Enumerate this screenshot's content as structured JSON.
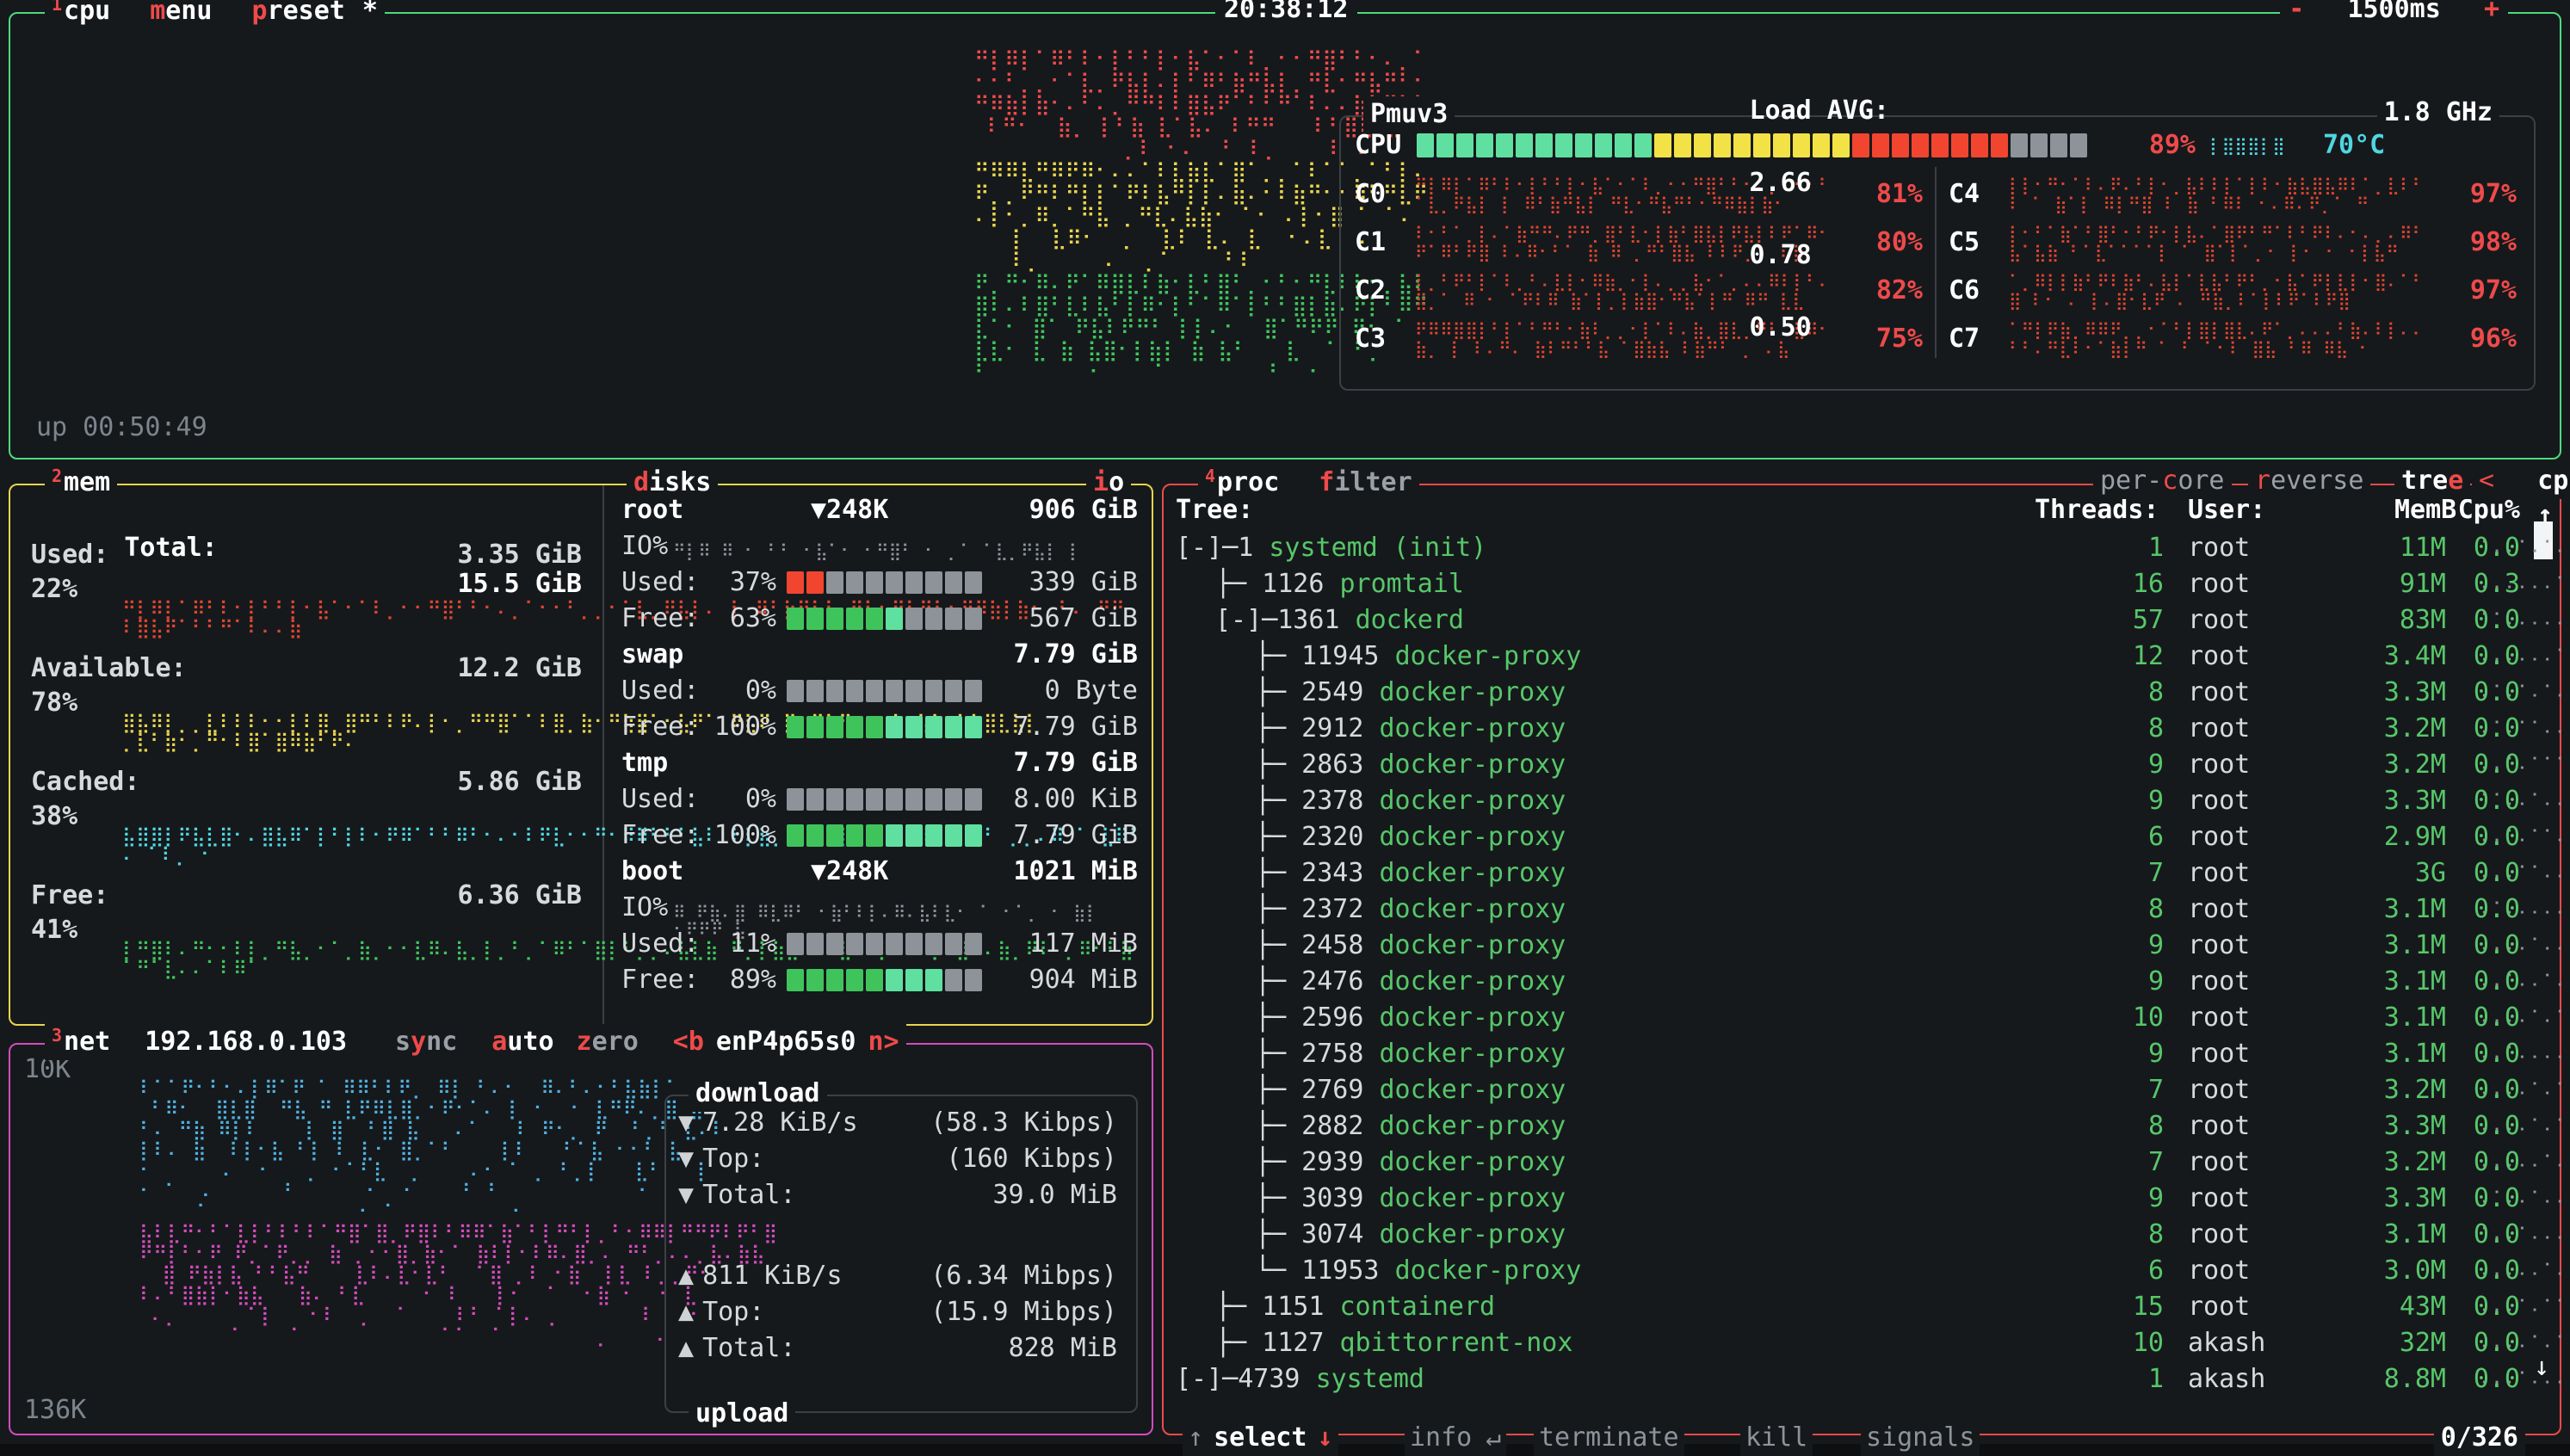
{
  "header": {
    "clock": "20:38:12",
    "update_minus": "-",
    "update_rate": "1500ms",
    "update_plus": "+"
  },
  "cpu": {
    "box_number": "1",
    "title": "cpu",
    "menu_label": "menu",
    "preset_label": "preset",
    "preset_value": "*",
    "uptime": "up 00:50:49",
    "model": "Pmuv3",
    "freq": "1.8 GHz",
    "total_label": "CPU",
    "total_pct": "89%",
    "temp": "70°C",
    "cores_left": [
      {
        "name": "C0",
        "pct": "81%"
      },
      {
        "name": "C1",
        "pct": "80%"
      },
      {
        "name": "C2",
        "pct": "82%"
      },
      {
        "name": "C3",
        "pct": "75%"
      }
    ],
    "cores_right": [
      {
        "name": "C4",
        "pct": "97%"
      },
      {
        "name": "C5",
        "pct": "98%"
      },
      {
        "name": "C6",
        "pct": "97%"
      },
      {
        "name": "C7",
        "pct": "96%"
      }
    ],
    "load_label": "Load AVG:",
    "load_1": "2.66",
    "load_5": "0.78",
    "load_15": "0.50"
  },
  "mem": {
    "box_number": "2",
    "title": "mem",
    "total_label": "Total:",
    "total_value": "15.5 GiB",
    "rows": [
      {
        "label": "Used:",
        "value": "3.35 GiB",
        "pct": "22%",
        "color": "#e0452f"
      },
      {
        "label": "Available:",
        "value": "12.2 GiB",
        "pct": "78%",
        "color": "#e8d44d"
      },
      {
        "label": "Cached:",
        "value": "5.86 GiB",
        "pct": "38%",
        "color": "#4fd6e0"
      },
      {
        "label": "Free:",
        "value": "6.36 GiB",
        "pct": "41%",
        "color": "#3fc45c"
      }
    ]
  },
  "disks": {
    "title": "disks",
    "io_title": "io",
    "entries": [
      {
        "name": "root",
        "io_rate": "▼248K",
        "size": "906 GiB",
        "io_label": "IO%",
        "has_io": true,
        "used_pct": "37%",
        "used_val": "339 GiB",
        "used_fill": 2,
        "free_pct": "63%",
        "free_val": "567 GiB",
        "free_fill": 6
      },
      {
        "name": "swap",
        "io_rate": "",
        "size": "7.79 GiB",
        "io_label": "",
        "has_io": false,
        "used_pct": "0%",
        "used_val": "0 Byte",
        "used_fill": 0,
        "free_pct": "100%",
        "free_val": "7.79 GiB",
        "free_fill": 10
      },
      {
        "name": "tmp",
        "io_rate": "",
        "size": "7.79 GiB",
        "io_label": "",
        "has_io": false,
        "used_pct": "0%",
        "used_val": "8.00 KiB",
        "used_fill": 0,
        "free_pct": "100%",
        "free_val": "7.79 GiB",
        "free_fill": 10
      },
      {
        "name": "boot",
        "io_rate": "▼248K",
        "size": "1021 MiB",
        "io_label": "IO%",
        "has_io": true,
        "used_pct": "11%",
        "used_val": "117 MiB",
        "used_fill": 0,
        "free_pct": "89%",
        "free_val": "904 MiB",
        "free_fill": 8
      }
    ],
    "used_label": "Used:",
    "free_label": "Free:"
  },
  "net": {
    "box_number": "3",
    "title": "net",
    "ip": "192.168.0.103",
    "sync_label": "sync",
    "auto_label": "auto",
    "zero_label": "zero",
    "iface_prev": "<b",
    "iface": "enP4p65s0",
    "iface_next": "n>",
    "scale_top": "10K",
    "scale_bottom": "136K",
    "download_title": "download",
    "upload_title": "upload",
    "download": [
      {
        "arrow": "▼",
        "label": "7.28 KiB/s",
        "value": "(58.3 Kibps)"
      },
      {
        "arrow": "▼",
        "label": "Top:",
        "value": "(160 Kibps)"
      },
      {
        "arrow": "▼",
        "label": "Total:",
        "value": "39.0 MiB"
      }
    ],
    "upload": [
      {
        "arrow": "▲",
        "label": "811 KiB/s",
        "value": "(6.34 Mibps)"
      },
      {
        "arrow": "▲",
        "label": "Top:",
        "value": "(15.9 Mibps)"
      },
      {
        "arrow": "▲",
        "label": "Total:",
        "value": "828 MiB"
      }
    ]
  },
  "proc": {
    "box_number": "4",
    "title": "proc",
    "filter_label": "filter",
    "filter_value": "",
    "per_core_label": "per-core",
    "reverse_label": "reverse",
    "tree_label": "tree",
    "sort_prev": "<",
    "sort_field": "cpu lazy",
    "sort_next": ">",
    "columns": {
      "tree": "Tree:",
      "threads": "Threads:",
      "user": "User:",
      "mem": "MemB",
      "cpu": "Cpu%"
    },
    "count": "0/326",
    "rows": [
      {
        "tree": "[-]─1 ",
        "cmd": "systemd (init)",
        "indent": 0,
        "threads": "1",
        "user": "root",
        "mem": "11M",
        "cpu": "0.0"
      },
      {
        "tree": "├─ 1126 ",
        "cmd": "promtail",
        "indent": 1,
        "threads": "16",
        "user": "root",
        "mem": "91M",
        "cpu": "0.3"
      },
      {
        "tree": "[-]─1361 ",
        "cmd": "dockerd",
        "indent": 1,
        "threads": "57",
        "user": "root",
        "mem": "83M",
        "cpu": "0.0"
      },
      {
        "tree": "├─ 11945 ",
        "cmd": "docker-proxy",
        "indent": 2,
        "threads": "12",
        "user": "root",
        "mem": "3.4M",
        "cpu": "0.0"
      },
      {
        "tree": "├─ 2549 ",
        "cmd": "docker-proxy",
        "indent": 2,
        "threads": "8",
        "user": "root",
        "mem": "3.3M",
        "cpu": "0.0"
      },
      {
        "tree": "├─ 2912 ",
        "cmd": "docker-proxy",
        "indent": 2,
        "threads": "8",
        "user": "root",
        "mem": "3.2M",
        "cpu": "0.0"
      },
      {
        "tree": "├─ 2863 ",
        "cmd": "docker-proxy",
        "indent": 2,
        "threads": "9",
        "user": "root",
        "mem": "3.2M",
        "cpu": "0.0"
      },
      {
        "tree": "├─ 2378 ",
        "cmd": "docker-proxy",
        "indent": 2,
        "threads": "9",
        "user": "root",
        "mem": "3.3M",
        "cpu": "0.0"
      },
      {
        "tree": "├─ 2320 ",
        "cmd": "docker-proxy",
        "indent": 2,
        "threads": "6",
        "user": "root",
        "mem": "2.9M",
        "cpu": "0.0"
      },
      {
        "tree": "├─ 2343 ",
        "cmd": "docker-proxy",
        "indent": 2,
        "threads": "7",
        "user": "root",
        "mem": "3G",
        "cpu": "0.0"
      },
      {
        "tree": "├─ 2372 ",
        "cmd": "docker-proxy",
        "indent": 2,
        "threads": "8",
        "user": "root",
        "mem": "3.1M",
        "cpu": "0.0"
      },
      {
        "tree": "├─ 2458 ",
        "cmd": "docker-proxy",
        "indent": 2,
        "threads": "9",
        "user": "root",
        "mem": "3.1M",
        "cpu": "0.0"
      },
      {
        "tree": "├─ 2476 ",
        "cmd": "docker-proxy",
        "indent": 2,
        "threads": "9",
        "user": "root",
        "mem": "3.1M",
        "cpu": "0.0"
      },
      {
        "tree": "├─ 2596 ",
        "cmd": "docker-proxy",
        "indent": 2,
        "threads": "10",
        "user": "root",
        "mem": "3.1M",
        "cpu": "0.0"
      },
      {
        "tree": "├─ 2758 ",
        "cmd": "docker-proxy",
        "indent": 2,
        "threads": "9",
        "user": "root",
        "mem": "3.1M",
        "cpu": "0.0"
      },
      {
        "tree": "├─ 2769 ",
        "cmd": "docker-proxy",
        "indent": 2,
        "threads": "7",
        "user": "root",
        "mem": "3.2M",
        "cpu": "0.0"
      },
      {
        "tree": "├─ 2882 ",
        "cmd": "docker-proxy",
        "indent": 2,
        "threads": "8",
        "user": "root",
        "mem": "3.3M",
        "cpu": "0.0"
      },
      {
        "tree": "├─ 2939 ",
        "cmd": "docker-proxy",
        "indent": 2,
        "threads": "7",
        "user": "root",
        "mem": "3.2M",
        "cpu": "0.0"
      },
      {
        "tree": "├─ 3039 ",
        "cmd": "docker-proxy",
        "indent": 2,
        "threads": "9",
        "user": "root",
        "mem": "3.3M",
        "cpu": "0.0"
      },
      {
        "tree": "├─ 3074 ",
        "cmd": "docker-proxy",
        "indent": 2,
        "threads": "8",
        "user": "root",
        "mem": "3.1M",
        "cpu": "0.0"
      },
      {
        "tree": "└─ 11953 ",
        "cmd": "docker-proxy",
        "indent": 2,
        "threads": "6",
        "user": "root",
        "mem": "3.0M",
        "cpu": "0.0"
      },
      {
        "tree": "├─ 1151 ",
        "cmd": "containerd",
        "indent": 1,
        "threads": "15",
        "user": "root",
        "mem": "43M",
        "cpu": "0.0"
      },
      {
        "tree": "├─ 1127 ",
        "cmd": "qbittorrent-nox",
        "indent": 1,
        "threads": "10",
        "user": "akash",
        "mem": "32M",
        "cpu": "0.0"
      },
      {
        "tree": "[-]─4739 ",
        "cmd": "systemd",
        "indent": 0,
        "threads": "1",
        "user": "akash",
        "mem": "8.8M",
        "cpu": "0.0"
      }
    ],
    "footer": [
      {
        "arrow": "↑",
        "key": "",
        "label": "select",
        "strong": true
      },
      {
        "arrow": "↓",
        "key": "",
        "label": "",
        "strong": false
      },
      {
        "arrow": "",
        "key": "",
        "label": "info",
        "strong": false
      },
      {
        "arrow": "↵",
        "key": "",
        "label": "terminate",
        "strong": false
      },
      {
        "arrow": "",
        "key": "",
        "label": "kill",
        "strong": false
      },
      {
        "arrow": "",
        "key": "",
        "label": "signals",
        "strong": false
      }
    ]
  },
  "colors": {
    "green": "#4ddb7e",
    "yellow": "#e8d44d",
    "red": "#ef4a4a",
    "magenta": "#d44bbd",
    "cyan": "#4fd6e0",
    "grey": "#8d9399",
    "bg": "#16191c"
  }
}
